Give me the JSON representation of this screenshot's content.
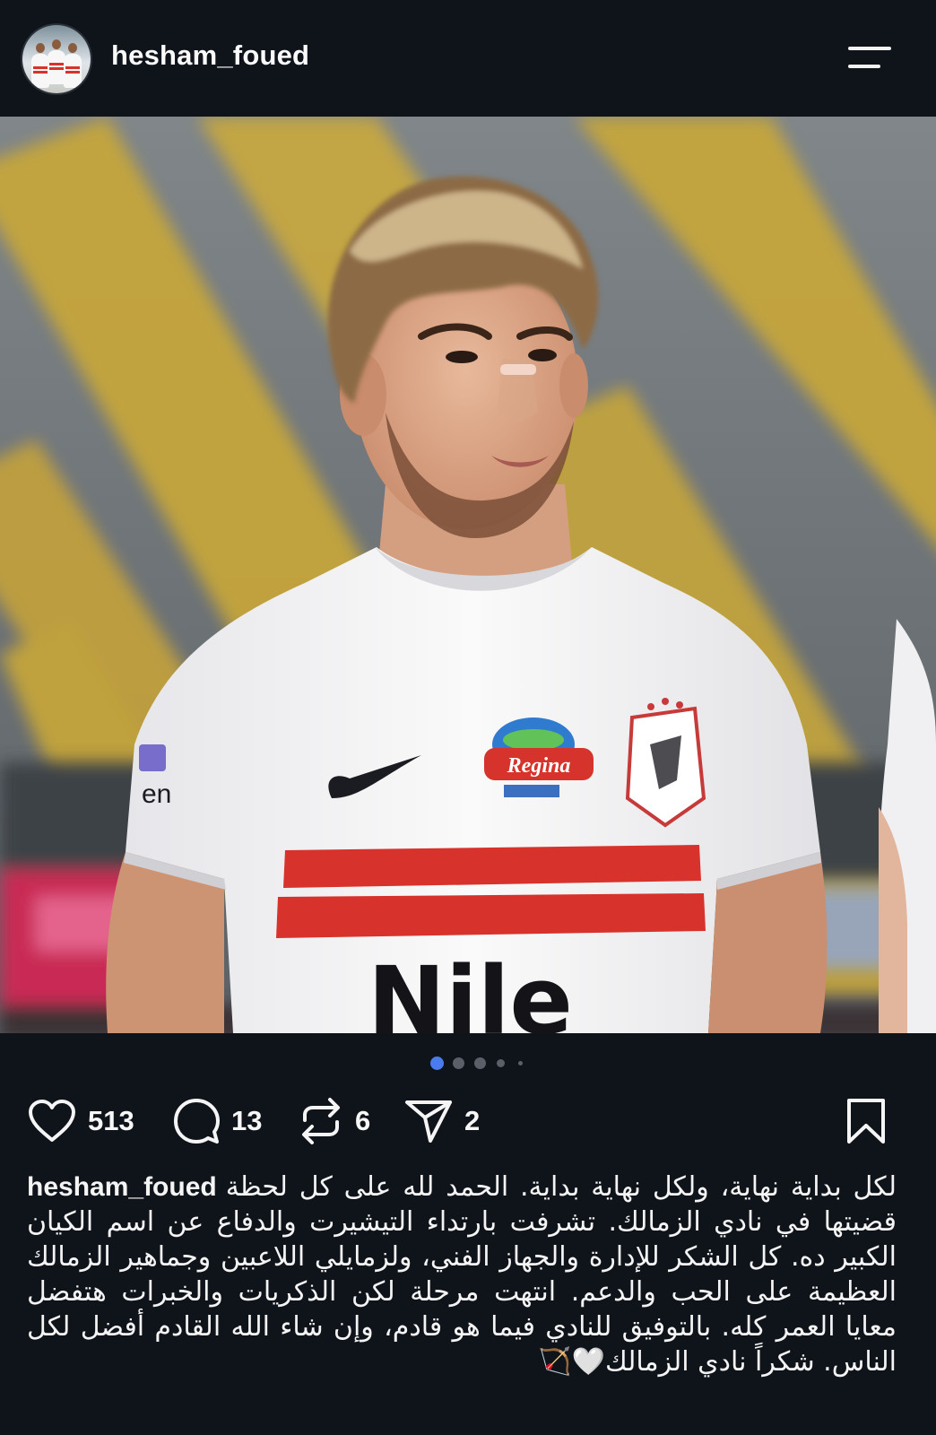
{
  "header": {
    "username": "hesham_foued",
    "menu_icon": "hamburger-menu-icon"
  },
  "post": {
    "carousel": {
      "count": 5,
      "active_index": 0
    },
    "actions": {
      "likes": "513",
      "comments": "13",
      "reposts": "6",
      "shares": "2"
    },
    "caption": {
      "username": "hesham_foued",
      "text": "لكل بداية نهاية، ولكل نهاية بداية. الحمد لله على كل لحظة قضيتها في نادي الزمالك. تشرفت بارتداء التيشيرت والدفاع عن اسم الكيان الكبير ده. كل الشكر للإدارة والجهاز الفني، ولزمايلي اللاعبين وجماهير الزمالك العظيمة على الحب والدعم. انتهت مرحلة لكن الذكريات والخبرات هتفضل معايا العمر كله. بالتوفيق للنادي فيما هو قادم، وإن شاء الله القادم أفضل لكل الناس. شكراً نادي الزمالك",
      "emoji": "🤍🏹"
    }
  },
  "shirt_print": {
    "sponsor": "Regina",
    "chest_text": "Nile"
  },
  "colors": {
    "background": "#0f131a",
    "text": "#f5f5f5",
    "dot_active": "#4a7cf0",
    "dot_inactive": "#5b6068",
    "stripe_red": "#d8322c"
  }
}
